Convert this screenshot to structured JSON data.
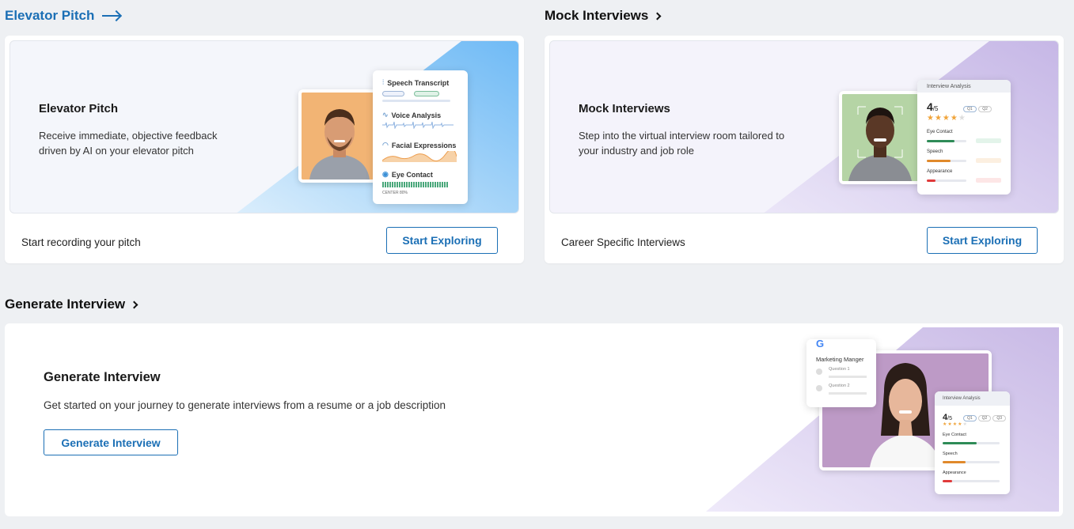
{
  "sections": {
    "elevator": {
      "heading": "Elevator Pitch",
      "card_title": "Elevator Pitch",
      "card_desc": "Receive immediate, objective feedback driven by AI on your elevator pitch",
      "footer_text": "Start recording your pitch",
      "button_label": "Start Exploring",
      "panel": {
        "speech_transcript": "Speech Transcript",
        "voice_analysis": "Voice Analysis",
        "facial_expressions": "Facial Expressions",
        "eye_contact": "Eye Contact",
        "center_label": "CENTER 80%"
      }
    },
    "mock": {
      "heading": "Mock Interviews",
      "card_title": "Mock Interviews",
      "card_desc": "Step into the virtual interview room tailored to your industry and job role",
      "footer_text": "Career Specific Interviews",
      "button_label": "Start Exploring",
      "panel": {
        "title": "Interview Analysis",
        "score": "4",
        "score_suffix": "/5",
        "q1": "Q1",
        "q2": "Q2",
        "eye_contact": "Eye Contact",
        "speech": "Speech",
        "appearance": "Appearance"
      }
    },
    "generate": {
      "heading": "Generate Interview",
      "card_title": "Generate Interview",
      "card_desc": "Get started on your journey to generate interviews from a resume or a job description",
      "button_label": "Generate Interview",
      "job_card": {
        "logo": "G",
        "role": "Marketing Manger",
        "question1": "Question 1",
        "question2": "Question 2"
      },
      "panel": {
        "title": "Interview Analysis",
        "score": "4",
        "score_suffix": "/5",
        "q1": "Q1",
        "q2": "Q2",
        "q3": "Q3",
        "eye_contact": "Eye Contact",
        "speech": "Speech",
        "appearance": "Appearance"
      }
    }
  },
  "colors": {
    "accent_blue": "#1b6fb5",
    "hero_blue": "#7cc2f7",
    "hero_purple": "#cbbde8",
    "bar_green": "#2e8b57",
    "bar_orange": "#e0892b",
    "bar_red": "#e03a3a"
  }
}
